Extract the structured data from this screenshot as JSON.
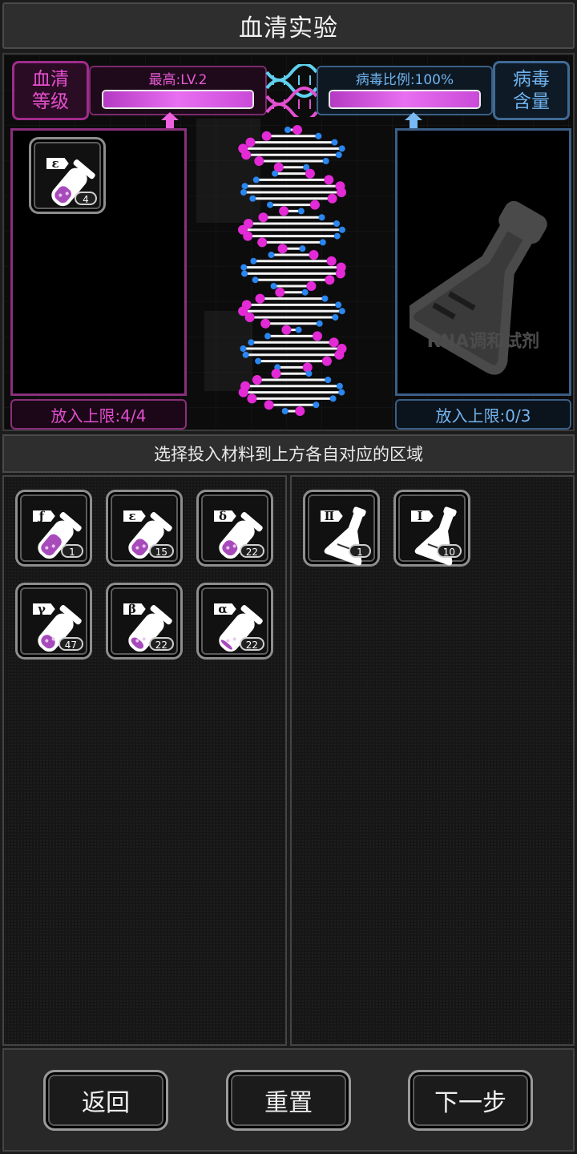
{
  "header": {
    "title": "血清实验"
  },
  "serum": {
    "tag_line1": "血清",
    "tag_line2": "等级",
    "bar_label": "最高:LV.2",
    "bar_level": 1.0,
    "limit_text": "放入上限:4/4",
    "slot_items": [
      {
        "glyph": "ε",
        "count": "4",
        "fill": 0.45
      }
    ]
  },
  "virus": {
    "tag_line1": "病毒",
    "tag_line2": "含量",
    "bar_label": "病毒比例:100%",
    "bar_level": 1.0,
    "limit_text": "放入上限:0/3",
    "placeholder_label": "RNA调和试剂"
  },
  "instruction": "选择投入材料到上方各自对应的区域",
  "inventory": {
    "serums": [
      {
        "glyph": "ƒ",
        "count": "1",
        "fill": 0.6
      },
      {
        "glyph": "ε",
        "count": "15",
        "fill": 0.45
      },
      {
        "glyph": "δ",
        "count": "22",
        "fill": 0.4
      },
      {
        "glyph": "γ",
        "count": "47",
        "fill": 0.35
      },
      {
        "glyph": "β",
        "count": "22",
        "fill": 0.25
      },
      {
        "glyph": "α",
        "count": "22",
        "fill": 0.15
      }
    ],
    "reagents": [
      {
        "glyph": "Ⅱ",
        "count": "1"
      },
      {
        "glyph": "Ⅰ",
        "count": "10"
      }
    ]
  },
  "buttons": {
    "back": "返回",
    "reset": "重置",
    "next": "下一步"
  },
  "colors": {
    "serum_accent": "#e84fd0",
    "virus_accent": "#6fb3ee",
    "liquid": "#a74bbb"
  },
  "icons": {
    "tube": "test-tube-icon",
    "flask": "flask-icon",
    "dna": "dna-helix-icon"
  }
}
